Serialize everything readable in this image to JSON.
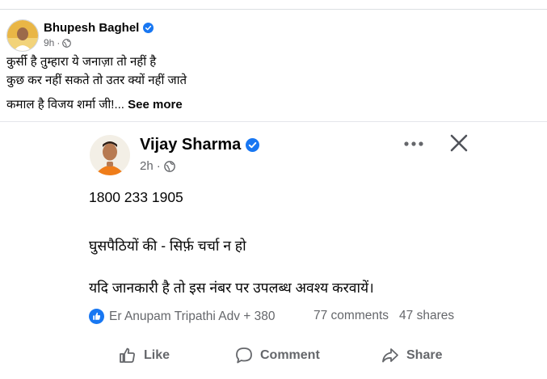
{
  "outer_post": {
    "author": "Bhupesh Baghel",
    "time": "9h",
    "text_line1": "कुर्सी है तुम्हारा ये जनाज़ा तो नहीं है",
    "text_line2": "कुछ कर नहीं सकते तो उतर क्यों नहीं जाते",
    "text_line3": "कमाल है विजय शर्मा जी!...",
    "see_more": "See more"
  },
  "shared_post": {
    "author": "Vijay Sharma",
    "time": "2h",
    "phone": "1800 233 1905",
    "line2": "घुसपैठियों की - सिर्फ़ चर्चा न हो",
    "line3": "यदि जानकारी है तो इस नंबर पर उपलब्ध अवश्य  करवायें।",
    "reactors": "Er Anupam Tripathi Adv + 380",
    "comments": "77 comments",
    "shares": "47 shares",
    "actions": {
      "like": "Like",
      "comment": "Comment",
      "share": "Share"
    }
  },
  "colors": {
    "facebook_blue": "#1877f2",
    "secondary_text": "#65676b",
    "divider": "#e4e6eb"
  },
  "icons": {
    "verified": "verified-badge-icon",
    "globe": "globe-icon",
    "more": "more-horizontal-icon",
    "close": "close-icon",
    "like_reaction": "thumbs-up-reaction-icon",
    "like": "thumbs-up-icon",
    "comment": "comment-bubble-icon",
    "share": "share-arrow-icon"
  }
}
